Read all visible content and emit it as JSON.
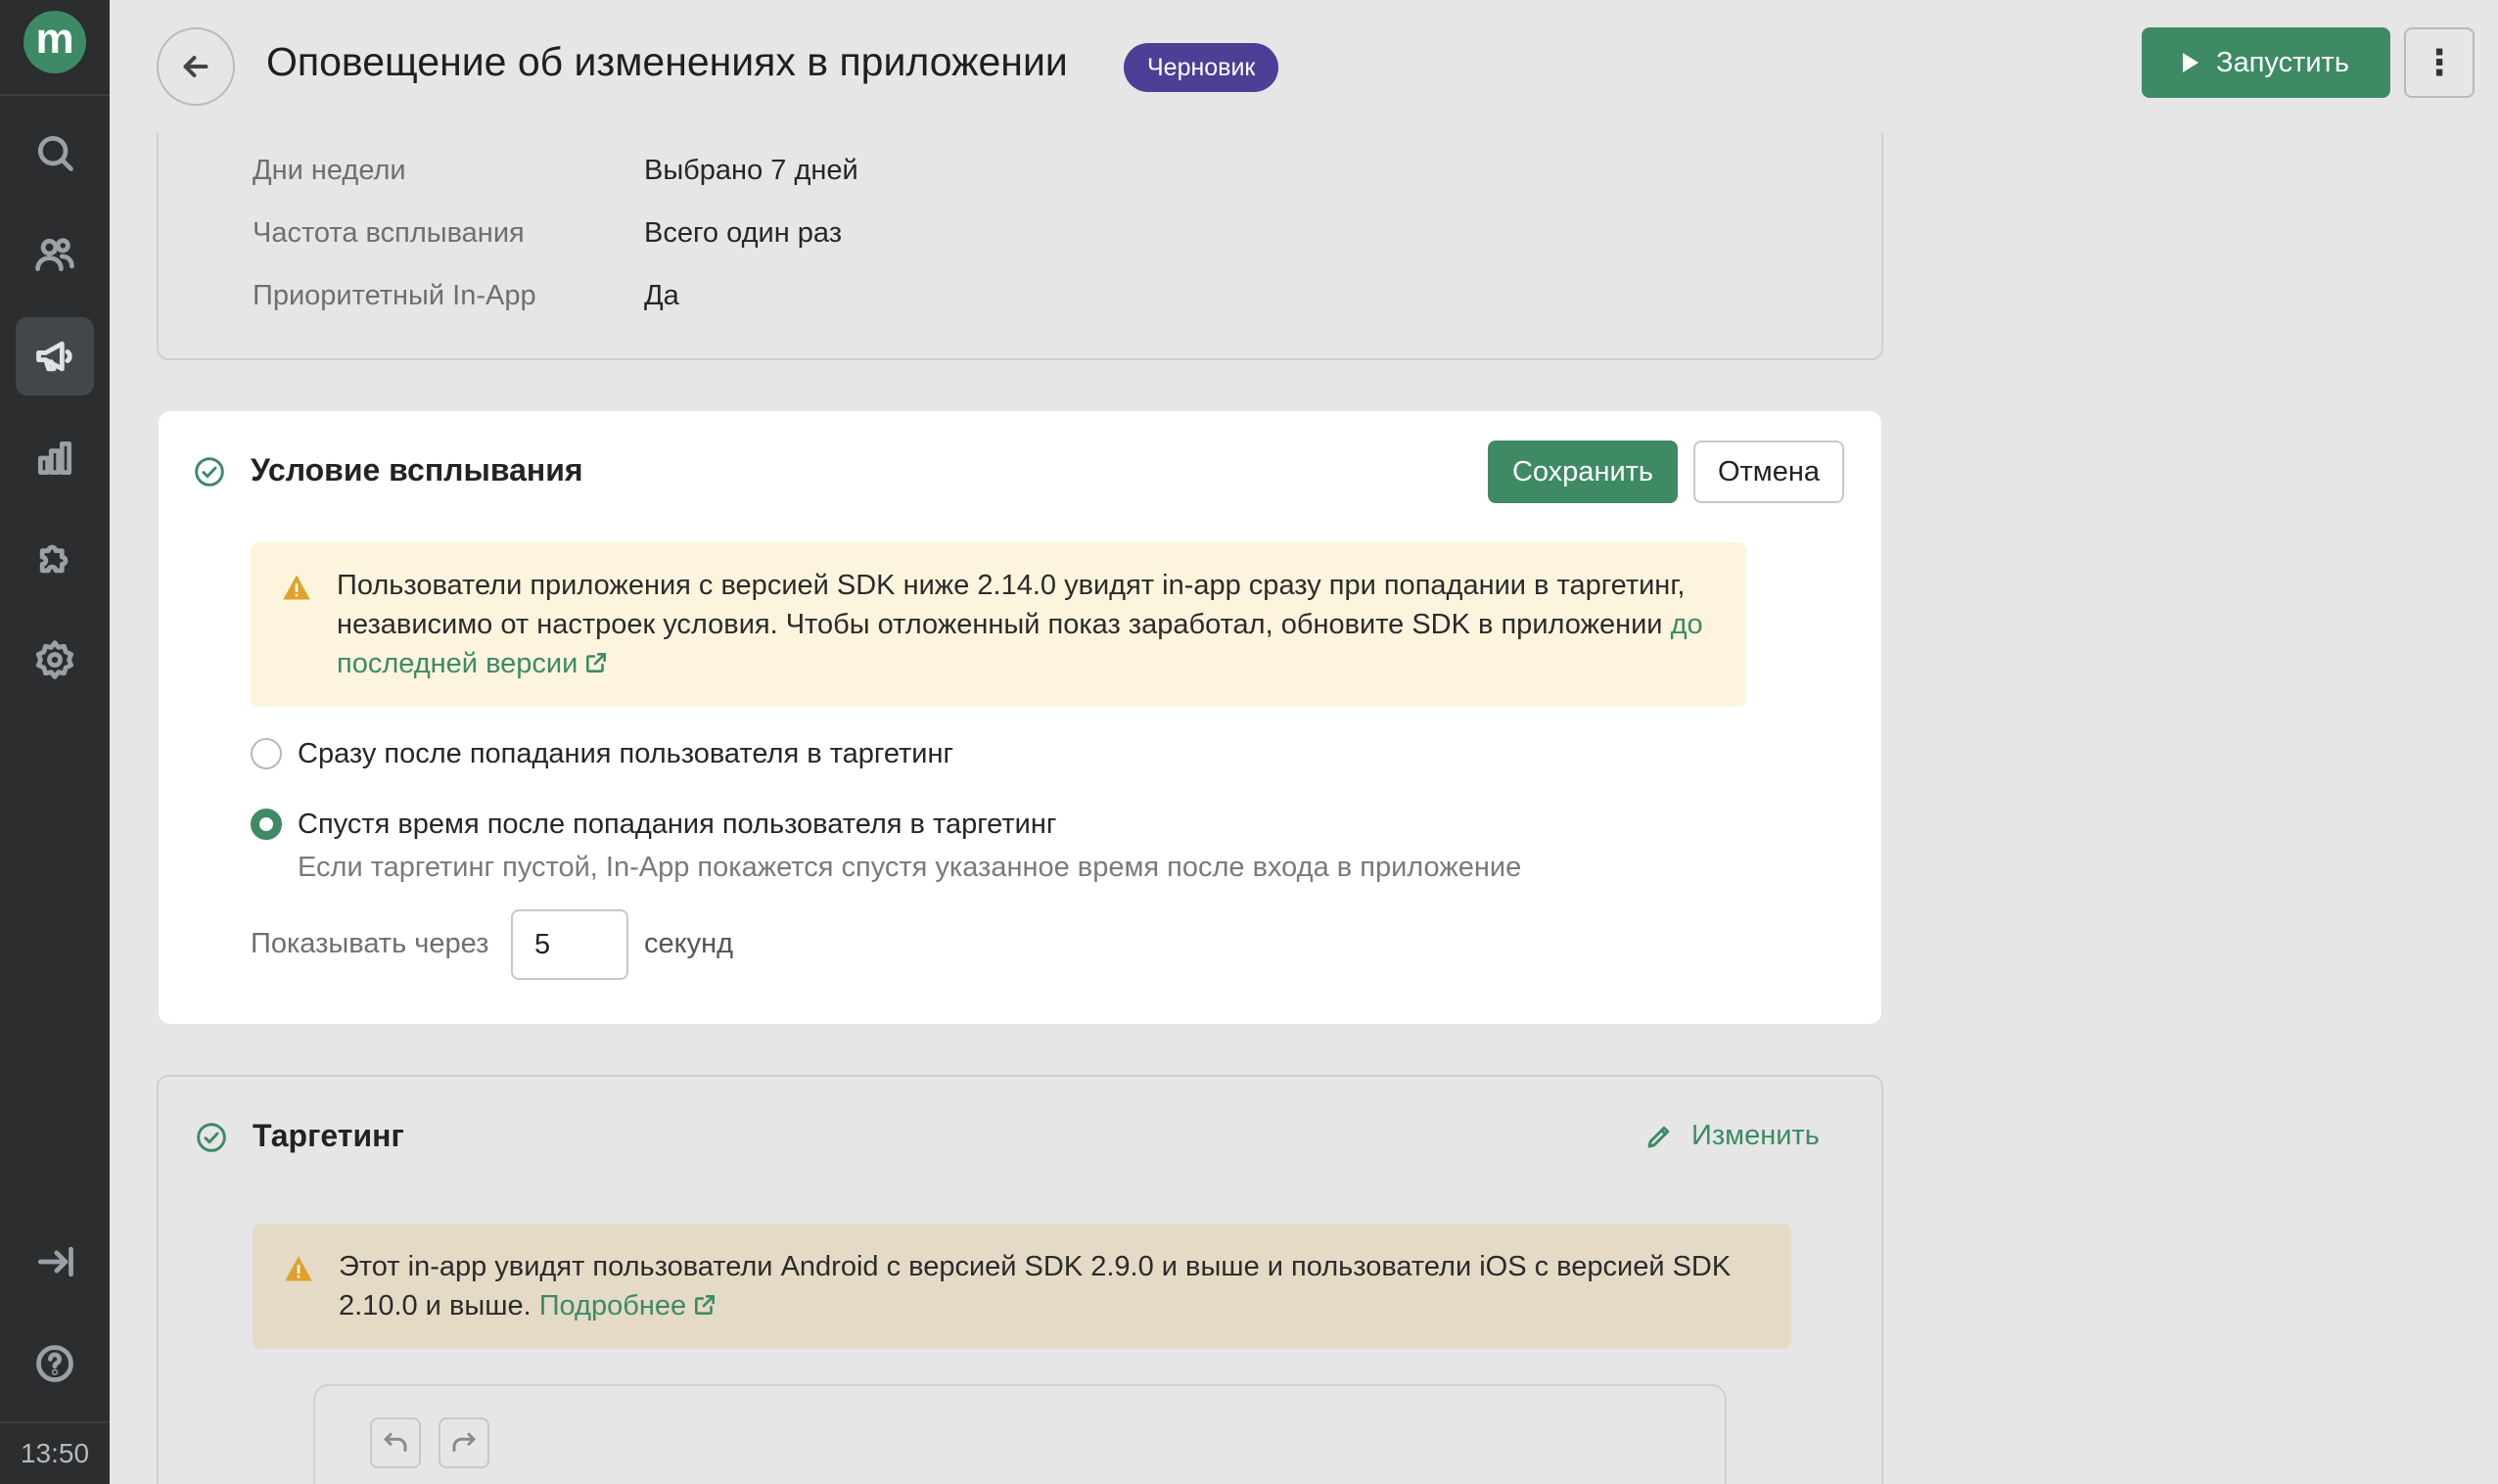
{
  "sidebar": {
    "logo_letter": "m",
    "items": [
      {
        "icon": "search-icon"
      },
      {
        "icon": "users-icon"
      },
      {
        "icon": "megaphone-icon",
        "active": true
      },
      {
        "icon": "analytics-icon"
      },
      {
        "icon": "puzzle-icon"
      },
      {
        "icon": "gear-icon"
      },
      {
        "icon": "logout-icon"
      },
      {
        "icon": "help-icon"
      }
    ],
    "clock": "13:50"
  },
  "header": {
    "title": "Оповещение об изменениях в приложении",
    "status_badge": "Черновик",
    "run_label": "Запустить"
  },
  "summary": {
    "rows": [
      {
        "label": "Дни недели",
        "value": "Выбрано 7 дней"
      },
      {
        "label": "Частота всплывания",
        "value": "Всего один раз"
      },
      {
        "label": "Приоритетный In-App",
        "value": "Да"
      }
    ]
  },
  "condition": {
    "title": "Условие всплывания",
    "save_label": "Сохранить",
    "cancel_label": "Отмена",
    "alert_text_1": "Пользователи приложения с версией SDK ниже 2.14.0 увидят in-app сразу при попадании в таргетинг, независимо от настроек условия. Чтобы отложенный показ заработал, обновите SDK в приложении ",
    "alert_link": "до последней версии",
    "option_immediate": "Сразу после попадания пользователя в таргетинг",
    "option_delayed": "Спустя время после попадания пользователя в таргетинг",
    "option_delayed_hint": "Если таргетинг пустой, In-App покажется спустя указанное время после входа в приложение",
    "selected_option": "delayed",
    "delay_label": "Показывать через",
    "delay_value": "5",
    "delay_unit": "секунд"
  },
  "targeting": {
    "title": "Таргетинг",
    "edit_label": "Изменить",
    "alert_text": "Этот in-app увидят пользователи Android с версией SDK 2.9.0 и выше и пользователи iOS с версией SDK 2.10.0 и выше. ",
    "alert_link": "Подробнее"
  },
  "colors": {
    "accent": "#3d8a65",
    "badge": "#4b3f96",
    "sidebar": "#2b2d2f",
    "alert_bg": "#fdf4dd",
    "warning": "#e0a22c"
  }
}
